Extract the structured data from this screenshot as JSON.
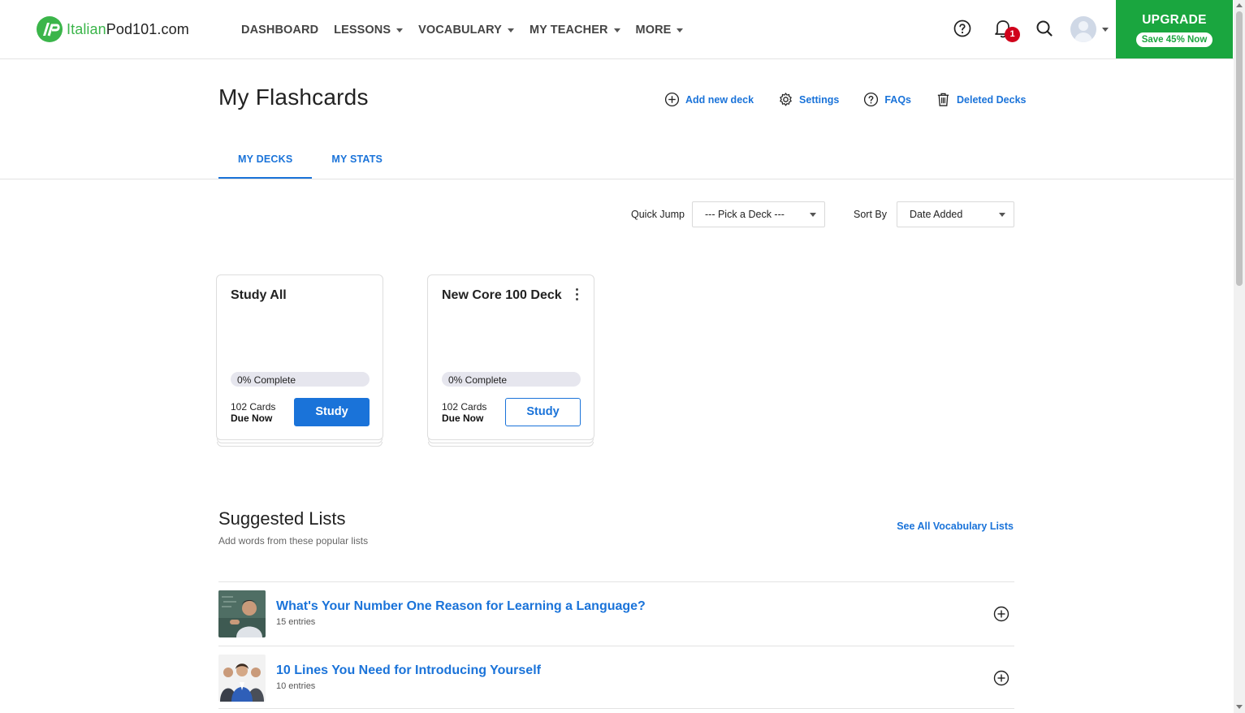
{
  "brand": {
    "name_part1": "Italian",
    "name_part2": "Pod101.com"
  },
  "nav": {
    "items": [
      {
        "label": "DASHBOARD",
        "dropdown": false
      },
      {
        "label": "LESSONS",
        "dropdown": true
      },
      {
        "label": "VOCABULARY",
        "dropdown": true
      },
      {
        "label": "MY TEACHER",
        "dropdown": true
      },
      {
        "label": "MORE",
        "dropdown": true
      }
    ],
    "notifications_count": "1",
    "upgrade": {
      "title": "UPGRADE",
      "subtitle": "Save 45% Now"
    }
  },
  "header": {
    "title": "My Flashcards",
    "actions": [
      {
        "label": "Add new deck",
        "icon": "plus-circle-icon"
      },
      {
        "label": "Settings",
        "icon": "gear-icon"
      },
      {
        "label": "FAQs",
        "icon": "help-circle-icon"
      },
      {
        "label": "Deleted Decks",
        "icon": "trash-icon"
      }
    ]
  },
  "tabs": [
    {
      "label": "MY DECKS",
      "active": true
    },
    {
      "label": "MY STATS",
      "active": false
    }
  ],
  "filters": {
    "quick_jump_label": "Quick Jump",
    "quick_jump_value": "--- Pick a Deck ---",
    "sort_label": "Sort By",
    "sort_value": "Date Added"
  },
  "decks": [
    {
      "title": "Study All",
      "progress_text": "0% Complete",
      "progress_fraction": 0,
      "cards": "102 Cards",
      "due": "Due Now",
      "button": "Study",
      "has_menu": false
    },
    {
      "title": "New Core 100 Deck",
      "progress_text": "0% Complete",
      "progress_fraction": 0,
      "cards": "102 Cards",
      "due": "Due Now",
      "button": "Study",
      "has_menu": true
    }
  ],
  "suggested": {
    "title": "Suggested Lists",
    "subtitle": "Add words from these popular lists",
    "see_all": "See All Vocabulary Lists",
    "lists": [
      {
        "name": "What's Your Number One Reason for Learning a Language?",
        "entries": "15 entries"
      },
      {
        "name": "10 Lines You Need for Introducing Yourself",
        "entries": "10 entries"
      }
    ]
  },
  "colors": {
    "accent": "#1a73d9",
    "upgrade": "#1aa63f",
    "badge": "#d0021b",
    "brand_green": "#3bb54a"
  }
}
